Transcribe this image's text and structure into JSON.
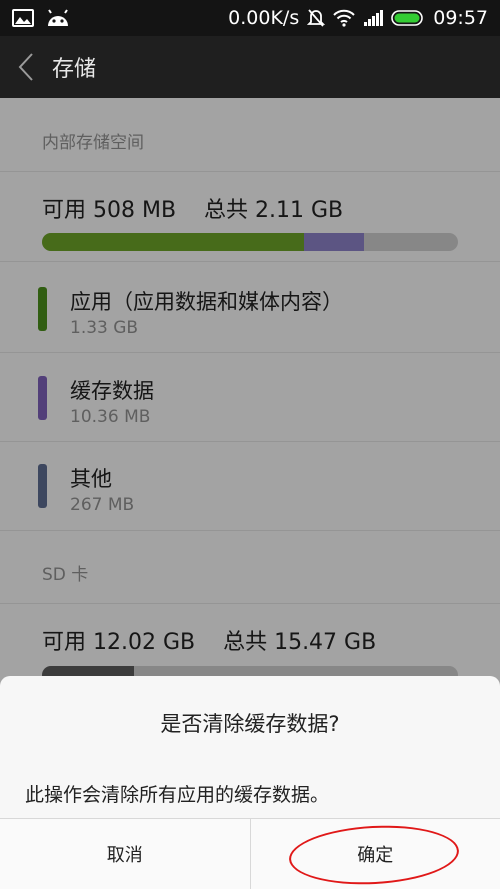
{
  "status_bar": {
    "net_speed": "0.00K/s",
    "time": "09:57",
    "icons": [
      "gallery-icon",
      "android-icon",
      "mute-bell-icon",
      "wifi-icon",
      "signal-icon",
      "battery-icon"
    ],
    "battery_color": "#33cc33"
  },
  "header": {
    "title": "存储"
  },
  "internal": {
    "section_label": "内部存储空间",
    "summary": "可用 508 MB    总共 2.11 GB",
    "usage": {
      "apps": 0.63,
      "cache": 0.145,
      "other": 0.0,
      "free": 0.225
    },
    "categories": [
      {
        "label": "应用（应用数据和媒体内容）",
        "size": "1.33 GB",
        "color": "#4a8c1c"
      },
      {
        "label": "缓存数据",
        "size": "10.36 MB",
        "color": "#7b5fb5"
      },
      {
        "label": "其他",
        "size": "267 MB",
        "color": "#5c6a8e"
      }
    ]
  },
  "sd": {
    "section_label": "SD 卡",
    "summary": "可用 12.02 GB    总共 15.47 GB",
    "usage": {
      "used": 0.22
    }
  },
  "dialog": {
    "title": "是否清除缓存数据?",
    "message": "此操作会清除所有应用的缓存数据。",
    "cancel_label": "取消",
    "confirm_label": "确定"
  },
  "colors": {
    "apps_bar": "#6aa028",
    "cache_bar": "#8a7fc4",
    "other_bar": "#8c8ec8",
    "free_bar": "#c9c9c9",
    "annotation": "#e01818"
  }
}
